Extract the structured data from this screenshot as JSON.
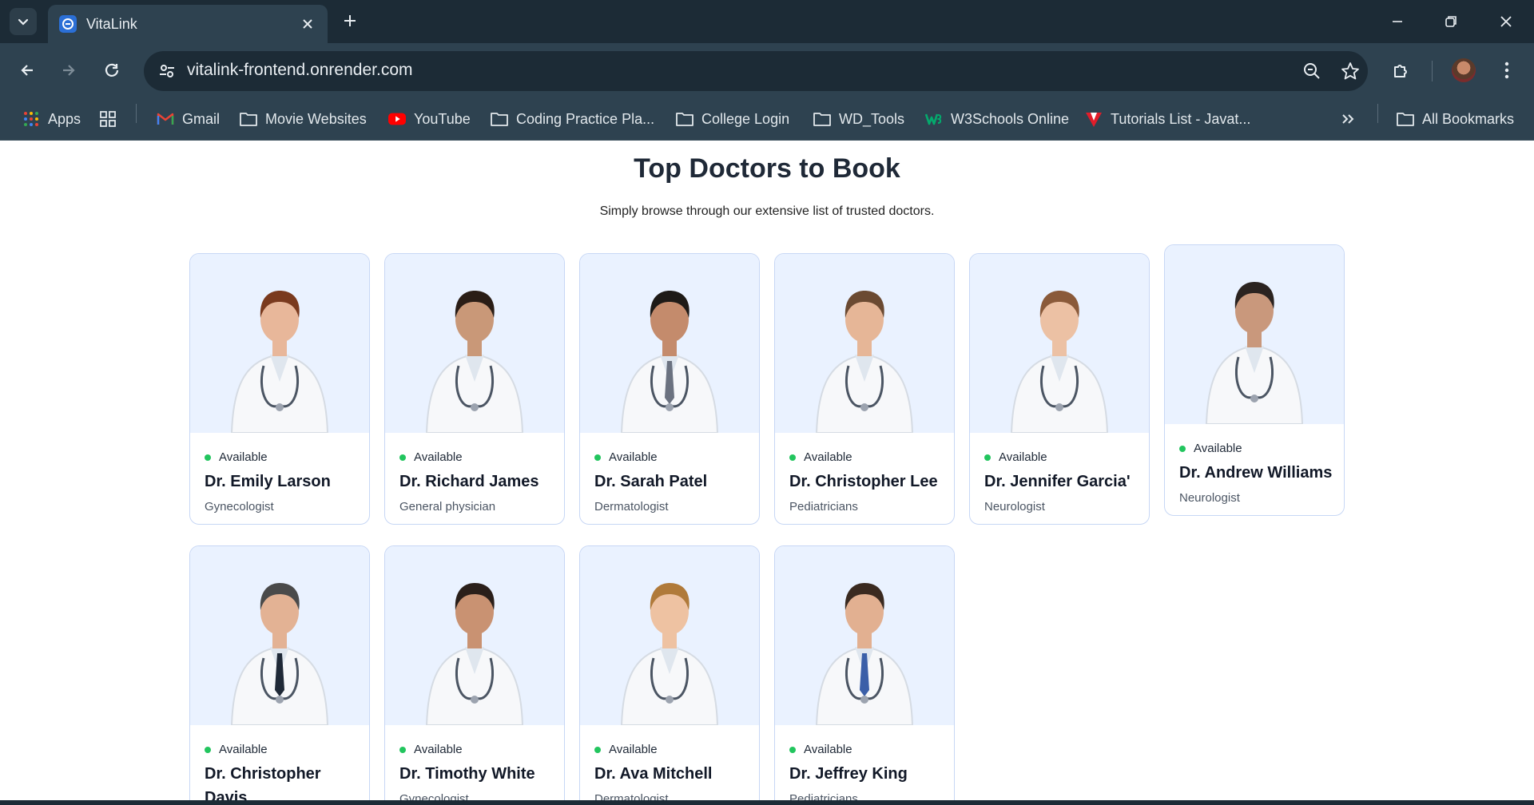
{
  "browser": {
    "tab_title": "VitaLink",
    "url": "vitalink-frontend.onrender.com",
    "bookmarks": [
      "Apps",
      "Gmail",
      "Movie Websites",
      "YouTube",
      "Coding Practice Pla...",
      "College Login",
      "WD_Tools",
      "W3Schools Online",
      "Tutorials List - Javat...",
      "All Bookmarks"
    ]
  },
  "page": {
    "title": "Top Doctors to Book",
    "subtitle": "Simply browse through our extensive list of trusted doctors."
  },
  "doctors": [
    {
      "status": "Available",
      "name": "Dr. Emily Larson",
      "speciality": "Gynecologist"
    },
    {
      "status": "Available",
      "name": "Dr. Richard James",
      "speciality": "General physician"
    },
    {
      "status": "Available",
      "name": "Dr. Sarah Patel",
      "speciality": "Dermatologist"
    },
    {
      "status": "Available",
      "name": "Dr. Christopher Lee",
      "speciality": "Pediatricians"
    },
    {
      "status": "Available",
      "name": "Dr. Jennifer Garcia'",
      "speciality": "Neurologist"
    },
    {
      "status": "Available",
      "name": "Dr. Andrew Williams",
      "speciality": "Neurologist"
    },
    {
      "status": "Available",
      "name": "Dr. Christopher Davis",
      "speciality": ""
    },
    {
      "status": "Available",
      "name": "Dr. Timothy White",
      "speciality": "Gynecologist"
    },
    {
      "status": "Available",
      "name": "Dr. Ava Mitchell",
      "speciality": "Dermatologist"
    },
    {
      "status": "Available",
      "name": "Dr. Jeffrey King",
      "speciality": "Pediatricians"
    }
  ],
  "colors": {
    "chrome_dark": "#1c2b36",
    "chrome": "#2e4250",
    "card_photo_bg": "#eaf2ff",
    "card_border": "#c7d7f5",
    "available_dot": "#22c55e"
  },
  "icons": {
    "tab_search": "chevron-down-icon",
    "favicon": "vitalink-favicon",
    "close": "close-icon",
    "new_tab": "plus-icon",
    "back": "arrow-left-icon",
    "forward": "arrow-right-icon",
    "reload": "reload-icon",
    "site_info": "tune-icon",
    "zoom": "zoom-icon",
    "star": "star-icon",
    "extensions": "puzzle-icon",
    "menu": "kebab-menu-icon"
  }
}
